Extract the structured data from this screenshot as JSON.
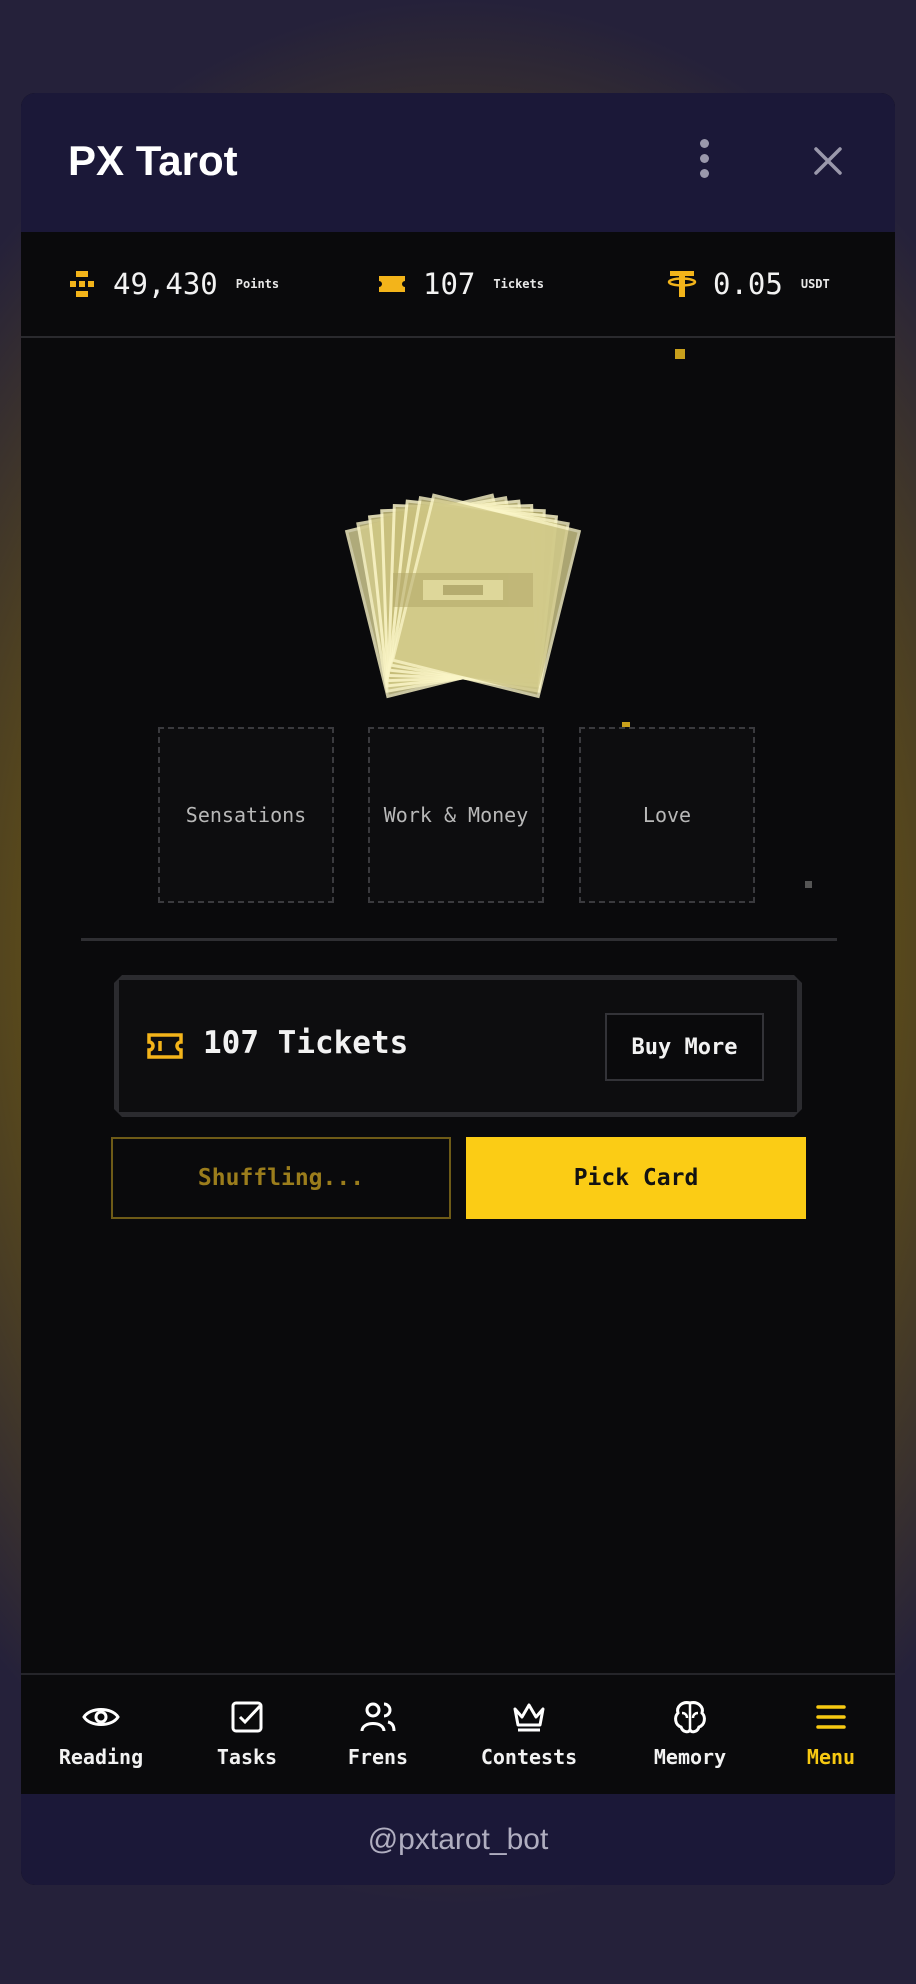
{
  "app": {
    "title": "PX Tarot",
    "handle": "@pxtarot_bot"
  },
  "stats": [
    {
      "icon": "points-icon",
      "value": "49,430",
      "unit": "Points"
    },
    {
      "icon": "ticket-icon",
      "value": "107",
      "unit": "Tickets"
    },
    {
      "icon": "usdt-icon",
      "value": "0.05",
      "unit": "USDT"
    }
  ],
  "spreads": [
    "Sensations",
    "Work & Money",
    "Love"
  ],
  "tickets": {
    "label": "107 Tickets",
    "buy_more": "Buy More"
  },
  "actions": {
    "shuffle": "Shuffling...",
    "pick": "Pick Card"
  },
  "nav": [
    {
      "label": "Reading",
      "icon": "eye-icon",
      "active": false
    },
    {
      "label": "Tasks",
      "icon": "checkbox-icon",
      "active": false
    },
    {
      "label": "Frens",
      "icon": "users-icon",
      "active": false
    },
    {
      "label": "Contests",
      "icon": "crown-icon",
      "active": false
    },
    {
      "label": "Memory",
      "icon": "brain-icon",
      "active": false
    },
    {
      "label": "Menu",
      "icon": "menu-icon",
      "active": true
    }
  ],
  "colors": {
    "accent": "#fbcc15",
    "header_bg": "#1b1838",
    "app_bg": "#0a0a0c",
    "card": "#e8e3a6"
  }
}
